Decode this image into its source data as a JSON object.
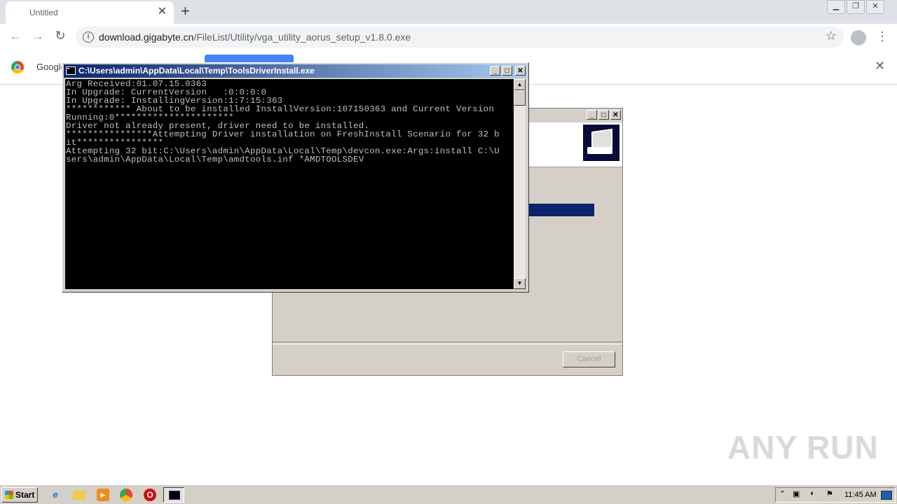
{
  "browser": {
    "tab_title": "Untitled",
    "tab_close": "✕",
    "new_tab": "+",
    "url_host": "download.gigabyte.cn",
    "url_path": "/FileList/Utility/vga_utility_aorus_setup_v1.8.0.exe",
    "back": "←",
    "forward": "→",
    "reload": "↻",
    "star": "☆",
    "menu": "⋮",
    "win_min": "▁",
    "win_restore": "❐",
    "win_close": "✕"
  },
  "infobar": {
    "text": "Google",
    "close": "✕"
  },
  "installer": {
    "btn_min": "_",
    "btn_max": "□",
    "btn_close": "✕",
    "progress_fraction": 0.999,
    "cancel_label": "Cancel"
  },
  "console": {
    "title": "C:\\Users\\admin\\AppData\\Local\\Temp\\ToolsDriverInstall.exe",
    "btn_min": "_",
    "btn_max": "□",
    "btn_close": "✕",
    "output": "Arg Received:01.07.15.0363\nIn Upgrade: CurrentVersion   :0:0:0:0\nIn Upgrade: InstallingVersion:1:7:15:363\n************ About to be installed InstallVersion:107150363 and Current Version\nRunning:0**********************\nDriver not already present, driver need to be installed.\n****************Attempting Driver installation on FreshInstall Scenario for 32 b\nit****************\nAttempting 32 bit:C:\\Users\\admin\\AppData\\Local\\Temp\\devcon.exe:Args:install C:\\U\nsers\\admin\\AppData\\Local\\Temp\\amdtools.inf *AMDTOOLSDEV",
    "scroll_up": "▲",
    "scroll_down": "▼"
  },
  "watermark": "ANY RUN",
  "taskbar": {
    "start_label": "Start",
    "ie_glyph": "e",
    "media_glyph": "▶",
    "opera_glyph": "O",
    "tray_arrow": "⌃",
    "clock": "11:45 AM"
  }
}
